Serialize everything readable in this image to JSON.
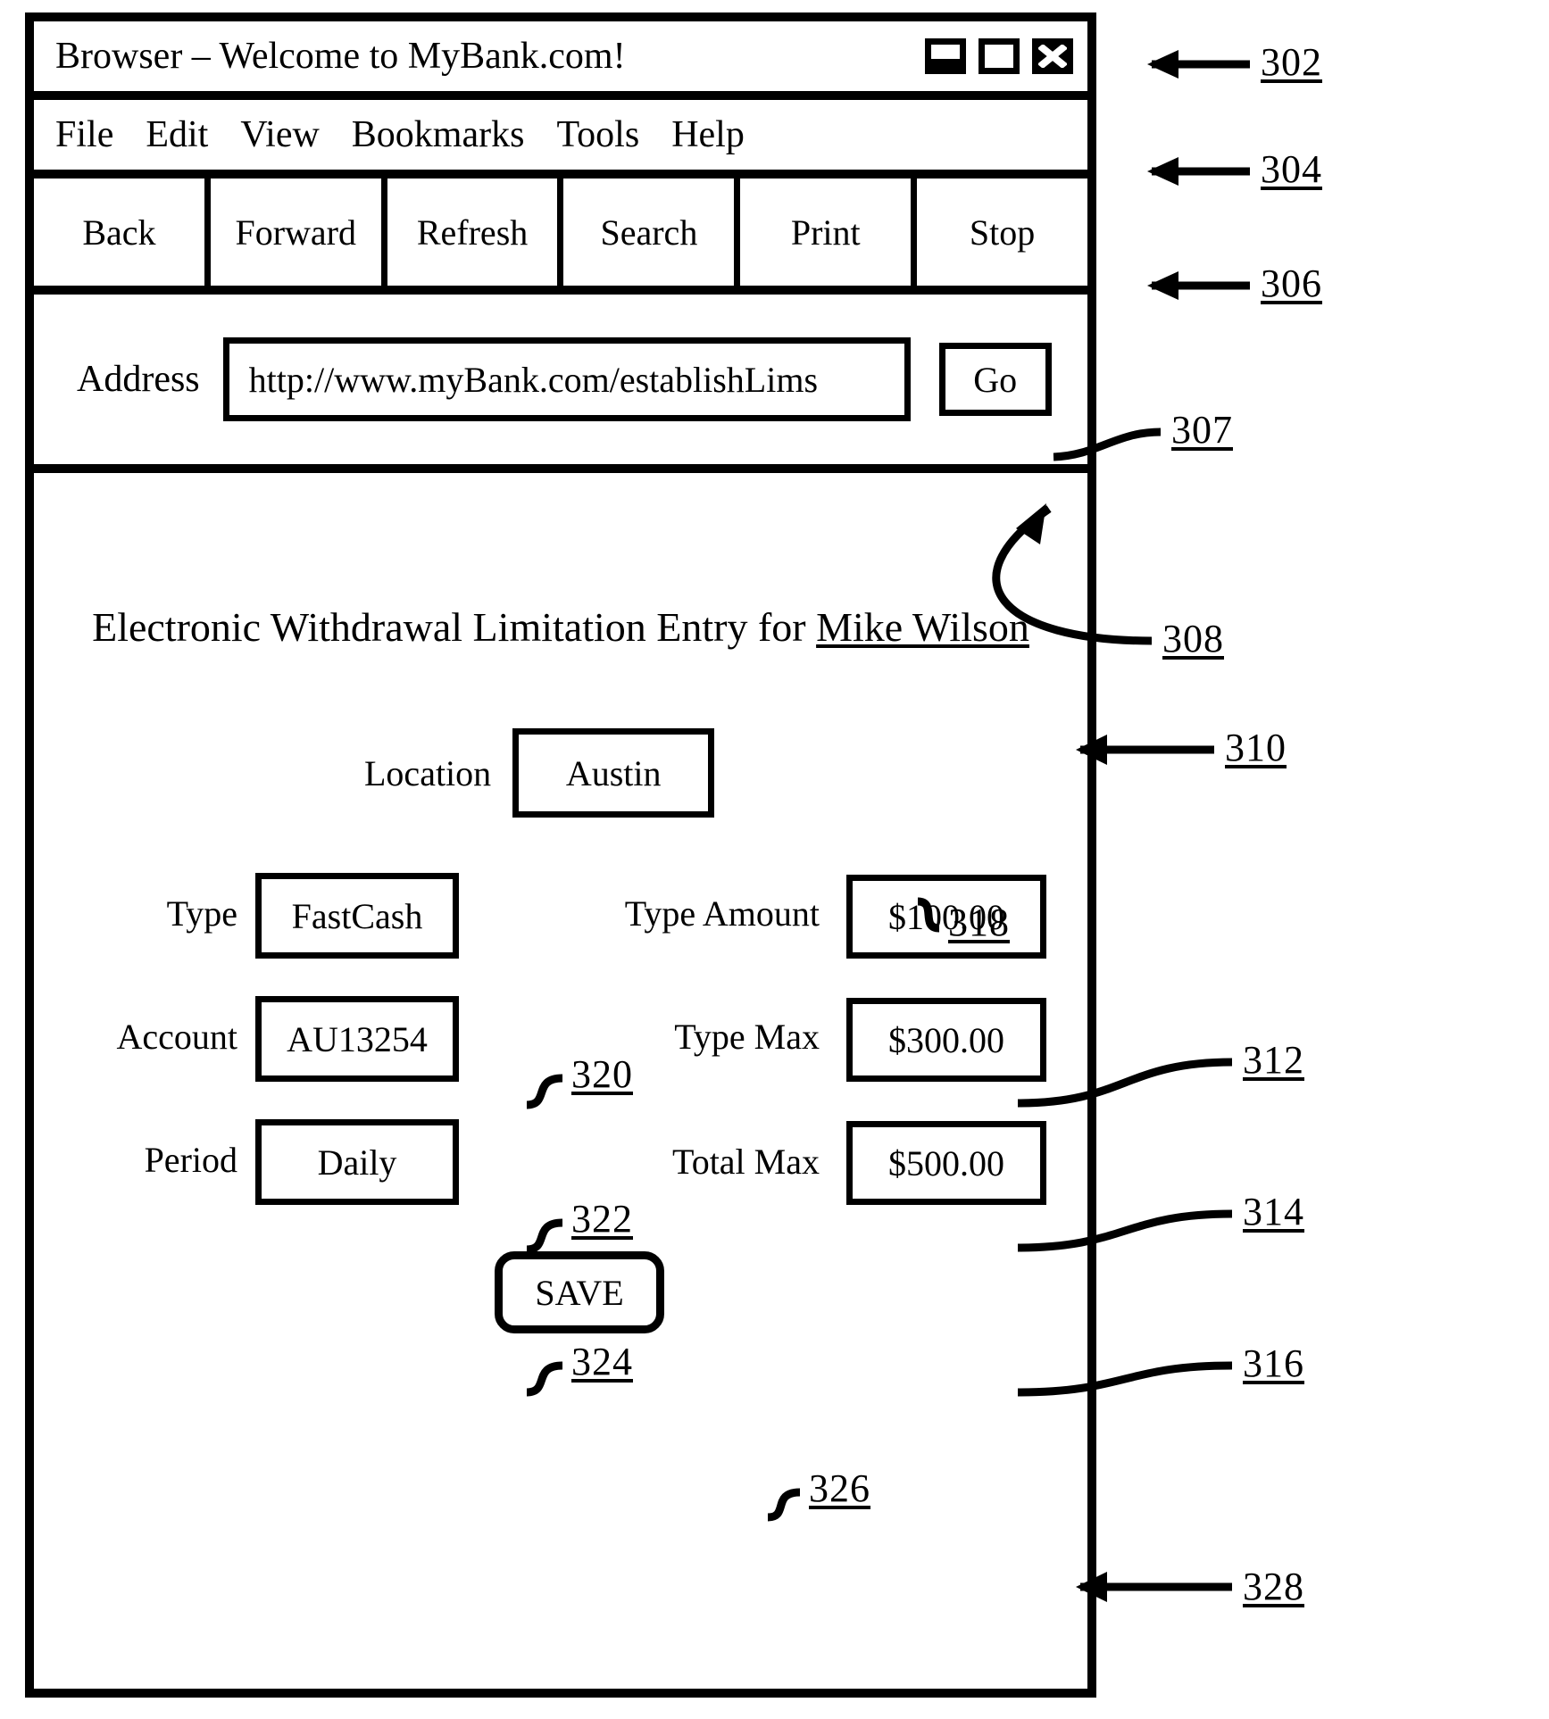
{
  "window": {
    "title": "Browser – Welcome to MyBank.com!",
    "controls": [
      {
        "name": "minimize-button",
        "icon": "minimize-icon"
      },
      {
        "name": "maximize-button",
        "icon": "maximize-icon"
      },
      {
        "name": "close-button",
        "icon": "close-icon"
      }
    ]
  },
  "menubar": {
    "items": [
      "File",
      "Edit",
      "View",
      "Bookmarks",
      "Tools",
      "Help"
    ]
  },
  "toolbar": {
    "buttons": [
      "Back",
      "Forward",
      "Refresh",
      "Search",
      "Print",
      "Stop"
    ]
  },
  "address_bar": {
    "label": "Address",
    "url": "http://www.myBank.com/establishLims",
    "go_label": "Go"
  },
  "page": {
    "heading_prefix": "Electronic Withdrawal Limitation Entry for ",
    "heading_user": "Mike Wilson",
    "fields": {
      "location": {
        "label": "Location",
        "value": "Austin"
      },
      "type": {
        "label": "Type",
        "value": "FastCash"
      },
      "account": {
        "label": "Account",
        "value": "AU13254"
      },
      "period": {
        "label": "Period",
        "value": "Daily"
      },
      "type_amount": {
        "label": "Type Amount",
        "value": "$100.00"
      },
      "type_max": {
        "label": "Type Max",
        "value": "$300.00"
      },
      "total_max": {
        "label": "Total  Max",
        "value": "$500.00"
      }
    },
    "save_label": "SAVE"
  },
  "reference_numerals": {
    "titlebar": "302",
    "menubar": "304",
    "toolbar": "306",
    "address_bar": "307",
    "address_field": "308",
    "heading": "310",
    "type_amount": "312",
    "type_max": "314",
    "total_max": "316",
    "location": "318",
    "type": "320",
    "account": "322",
    "period": "324",
    "save": "326",
    "page_body": "328"
  }
}
